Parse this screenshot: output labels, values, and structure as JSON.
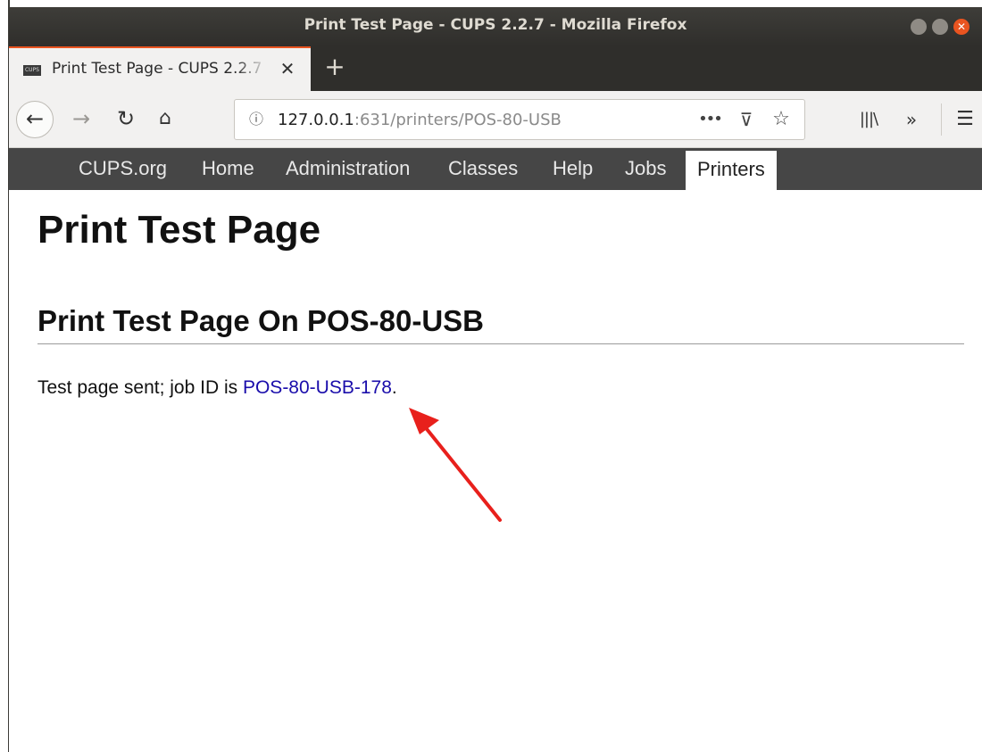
{
  "window": {
    "title": "Print Test Page - CUPS 2.2.7 - Mozilla Firefox",
    "close_glyph": "✕"
  },
  "tab": {
    "favicon_text": "CUPS",
    "title": "Print Test Page - CUPS 2.2.7",
    "close_glyph": "✕",
    "new_tab_glyph": "+"
  },
  "nav": {
    "back_glyph": "←",
    "forward_glyph": "→",
    "reload_glyph": "↻",
    "home_glyph": "⌂",
    "url_info_glyph": "ⓘ",
    "url_host": "127.0.0.1",
    "url_rest": ":631/printers/POS-80-USB",
    "more_glyph": "•••",
    "pocket_glyph": "⊽",
    "star_glyph": "☆",
    "library_glyph": "|||\\",
    "overflow_glyph": "»",
    "menu_glyph": "☰"
  },
  "cups_nav": {
    "items": [
      "CUPS.org",
      "Home",
      "Administration",
      "Classes",
      "Help",
      "Jobs",
      "Printers"
    ],
    "active": "Printers"
  },
  "page": {
    "heading": "Print Test Page",
    "subheading": "Print Test Page On POS-80-USB",
    "message_prefix": "Test page sent; job ID is ",
    "job_link": "POS-80-USB-178",
    "message_suffix": "."
  },
  "colors": {
    "accent": "#e95420",
    "link": "#1a0dab",
    "annotation_arrow": "#e8201c"
  }
}
